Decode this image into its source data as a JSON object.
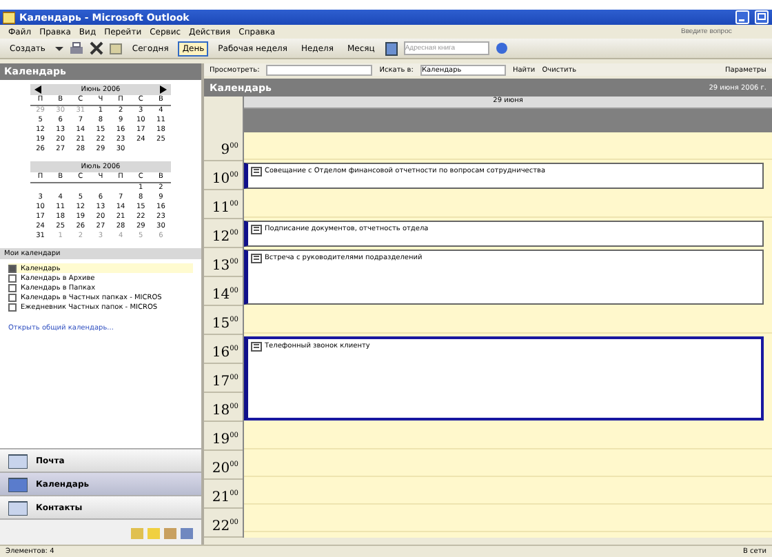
{
  "window": {
    "title": "Календарь - Microsoft Outlook"
  },
  "menu": [
    "Файл",
    "Правка",
    "Вид",
    "Перейти",
    "Сервис",
    "Действия",
    "Справка"
  ],
  "help_box": {
    "placeholder": "Введите вопрос"
  },
  "toolbar": [
    {
      "kind": "button",
      "label": "Создать",
      "selected": false
    },
    {
      "kind": "button",
      "label": "Сегодня",
      "selected": false
    },
    {
      "kind": "button",
      "label": "День",
      "selected": true
    },
    {
      "kind": "button",
      "label": "Рабочая неделя",
      "selected": false
    },
    {
      "kind": "button",
      "label": "Неделя",
      "selected": false
    },
    {
      "kind": "button",
      "label": "Месяц",
      "selected": false
    },
    {
      "kind": "field",
      "placeholder": "Адресная книга"
    }
  ],
  "sidebar": {
    "title": "Календарь",
    "months": [
      {
        "title": "Июнь 2006",
        "weekdays": [
          "П",
          "В",
          "С",
          "Ч",
          "П",
          "С",
          "В"
        ],
        "weeks": [
          [
            {
              "day": "29",
              "muted": true
            },
            {
              "day": "30",
              "muted": true
            },
            {
              "day": "31",
              "muted": true
            },
            {
              "day": "1",
              "muted": false
            },
            {
              "day": "2",
              "muted": false
            },
            {
              "day": "3",
              "muted": false
            },
            {
              "day": "4",
              "muted": false
            }
          ],
          [
            {
              "day": "5",
              "muted": false
            },
            {
              "day": "6",
              "muted": false
            },
            {
              "day": "7",
              "muted": false
            },
            {
              "day": "8",
              "muted": false
            },
            {
              "day": "9",
              "muted": false
            },
            {
              "day": "10",
              "muted": false
            },
            {
              "day": "11",
              "muted": false
            }
          ],
          [
            {
              "day": "12",
              "muted": false
            },
            {
              "day": "13",
              "muted": false
            },
            {
              "day": "14",
              "muted": false
            },
            {
              "day": "15",
              "muted": false
            },
            {
              "day": "16",
              "muted": false
            },
            {
              "day": "17",
              "muted": false
            },
            {
              "day": "18",
              "muted": false
            }
          ],
          [
            {
              "day": "19",
              "muted": false
            },
            {
              "day": "20",
              "muted": false
            },
            {
              "day": "21",
              "muted": false
            },
            {
              "day": "22",
              "muted": false
            },
            {
              "day": "23",
              "muted": false
            },
            {
              "day": "24",
              "muted": false
            },
            {
              "day": "25",
              "muted": false
            }
          ],
          [
            {
              "day": "26",
              "muted": false
            },
            {
              "day": "27",
              "muted": false
            },
            {
              "day": "28",
              "muted": false
            },
            {
              "day": "29",
              "muted": false
            },
            {
              "day": "30",
              "muted": false
            }
          ]
        ]
      },
      {
        "title": "Июль 2006",
        "weekdays": [
          "П",
          "В",
          "С",
          "Ч",
          "П",
          "С",
          "В"
        ],
        "weeks": [
          [
            {
              "day": "1",
              "muted": false
            },
            {
              "day": "2",
              "muted": false
            }
          ],
          [
            {
              "day": "3",
              "muted": false
            },
            {
              "day": "4",
              "muted": false
            },
            {
              "day": "5",
              "muted": false
            },
            {
              "day": "6",
              "muted": false
            },
            {
              "day": "7",
              "muted": false
            },
            {
              "day": "8",
              "muted": false
            },
            {
              "day": "9",
              "muted": false
            }
          ],
          [
            {
              "day": "10",
              "muted": false
            },
            {
              "day": "11",
              "muted": false
            },
            {
              "day": "12",
              "muted": false
            },
            {
              "day": "13",
              "muted": false
            },
            {
              "day": "14",
              "muted": false
            },
            {
              "day": "15",
              "muted": false
            },
            {
              "day": "16",
              "muted": false
            }
          ],
          [
            {
              "day": "17",
              "muted": false
            },
            {
              "day": "18",
              "muted": false
            },
            {
              "day": "19",
              "muted": false
            },
            {
              "day": "20",
              "muted": false
            },
            {
              "day": "21",
              "muted": false
            },
            {
              "day": "22",
              "muted": false
            },
            {
              "day": "23",
              "muted": false
            }
          ],
          [
            {
              "day": "24",
              "muted": false
            },
            {
              "day": "25",
              "muted": false
            },
            {
              "day": "26",
              "muted": false
            },
            {
              "day": "27",
              "muted": false
            },
            {
              "day": "28",
              "muted": false
            },
            {
              "day": "29",
              "muted": false
            },
            {
              "day": "30",
              "muted": false
            }
          ],
          [
            {
              "day": "31",
              "muted": false
            },
            {
              "day": "1",
              "muted": true
            },
            {
              "day": "2",
              "muted": true
            },
            {
              "day": "3",
              "muted": true
            },
            {
              "day": "4",
              "muted": true
            },
            {
              "day": "5",
              "muted": true
            },
            {
              "day": "6",
              "muted": true
            }
          ]
        ]
      }
    ],
    "calendars_title": "Мои календари",
    "calendars": [
      {
        "label": "Календарь",
        "checked": true,
        "selected": true
      },
      {
        "label": "Календарь в Архиве",
        "checked": false,
        "selected": false
      },
      {
        "label": "Календарь в Папках",
        "checked": false,
        "selected": false
      },
      {
        "label": "Календарь в Частных папках - MICROS",
        "checked": false,
        "selected": false
      },
      {
        "label": "Ежедневник Частных папок - MICROS",
        "checked": false,
        "selected": false
      }
    ],
    "open_link": "Открыть общий календарь...",
    "nav": [
      {
        "label": "Почта",
        "selected": false
      },
      {
        "label": "Календарь",
        "selected": true
      },
      {
        "label": "Контакты",
        "selected": false
      }
    ]
  },
  "search": {
    "label": "Просмотреть:",
    "scope": "Искать в:",
    "scope_value": "Календарь",
    "find": "Найти",
    "clear": "Очистить",
    "options": "Параметры"
  },
  "calendar": {
    "title": "Календарь",
    "date": "29 июня 2006 г.",
    "day_header": "29 июня",
    "timeline": [
      {
        "kind": "free",
        "hours": [
          "9$^{00}$"
        ]
      },
      {
        "kind": "appointment",
        "hours": [
          "10$^{00}$"
        ],
        "subject": "Совещание с Отделом финансовой отчетности по вопросам сотрудничества",
        "selected": false
      },
      {
        "kind": "free",
        "hours": [
          "11$^{00}$"
        ]
      },
      {
        "kind": "appointment",
        "hours": [
          "12$^{00}$"
        ],
        "subject": "Подписание документов, отчетность отдела",
        "selected": false
      },
      {
        "kind": "appointment",
        "hours": [
          "13$^{00}$",
          "14$^{00}$"
        ],
        "subject": "Встреча с руководителями подразделений",
        "selected": false
      },
      {
        "kind": "free",
        "hours": [
          "15$^{00}$"
        ]
      },
      {
        "kind": "appointment",
        "hours": [
          "16$^{00}$",
          "17$^{00}$",
          "18$^{00}$"
        ],
        "subject": "Телефонный звонок клиенту",
        "selected": true
      },
      {
        "kind": "free",
        "hours": [
          "19$^{00}$",
          "20$^{00}$",
          "21$^{00}$",
          "22$^{00}$"
        ]
      }
    ]
  },
  "status_bar": {
    "left": "Элементов: 4",
    "right": "В сети"
  }
}
